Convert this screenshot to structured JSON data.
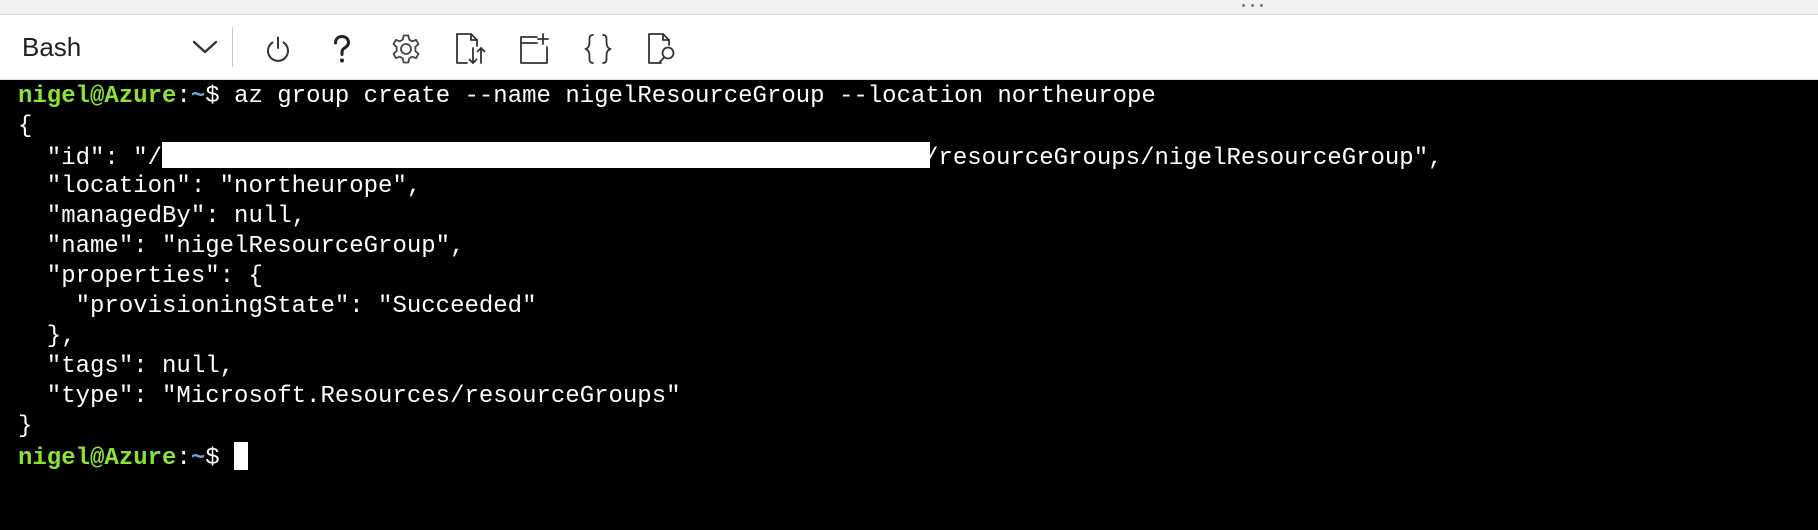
{
  "window": {
    "drag_handle": "• • •"
  },
  "toolbar": {
    "shell_label": "Bash",
    "shell_options_icon": "chevron-down-icon",
    "buttons": [
      {
        "name": "restart",
        "icon": "power-icon"
      },
      {
        "name": "help",
        "icon": "question-icon"
      },
      {
        "name": "settings",
        "icon": "gear-icon"
      },
      {
        "name": "upload-download",
        "icon": "file-transfer-icon"
      },
      {
        "name": "new-session",
        "icon": "new-session-icon"
      },
      {
        "name": "editor",
        "icon": "braces-icon"
      },
      {
        "name": "web-preview",
        "icon": "file-search-icon"
      }
    ]
  },
  "terminal": {
    "prompt_user": "nigel@Azure",
    "prompt_sep": ":",
    "prompt_path": "~",
    "prompt_suffix": "$ ",
    "command": "az group create --name nigelResourceGroup --location northeurope",
    "output": {
      "open_brace": "{",
      "id_prefix": "  \"id\": \"/",
      "id_suffix": "/resourceGroups/nigelResourceGroup\",",
      "location": "  \"location\": \"northeurope\",",
      "managed_by": "  \"managedBy\": null,",
      "name": "  \"name\": \"nigelResourceGroup\",",
      "properties_open": "  \"properties\": {",
      "provisioning_state": "    \"provisioningState\": \"Succeeded\"",
      "properties_close": "  },",
      "tags": "  \"tags\": null,",
      "type": "  \"type\": \"Microsoft.Resources/resourceGroups\"",
      "close_brace": "}"
    }
  },
  "colors": {
    "terminal_bg": "#000000",
    "terminal_fg": "#ffffff",
    "prompt_user": "#8ae234",
    "prompt_path": "#729fcf",
    "toolbar_bg": "#ffffff"
  }
}
